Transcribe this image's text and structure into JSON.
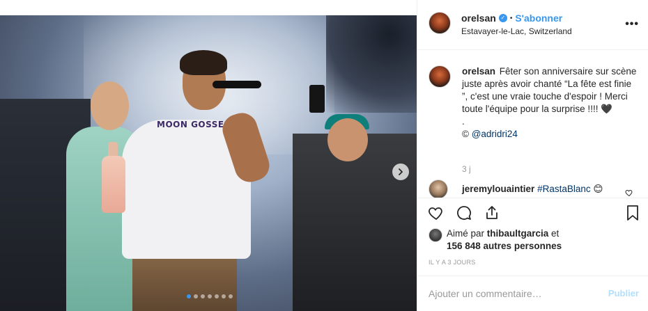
{
  "post": {
    "user": {
      "name": "orelsan",
      "verified": true,
      "follow_label": "S'abonner",
      "separator": "•",
      "location": "Estavayer-le-Lac, Switzerland"
    },
    "photo": {
      "shirt_text": "MOON GOSSE",
      "slide_count": 7,
      "active_slide": 0
    },
    "caption": {
      "username": "orelsan",
      "text": "Fêter son anniversaire sur scène juste après avoir chanté “La fête est finie ”, c'est une vraie touche d'espoir ! Merci toute l'équipe pour la surprise !!!! 🖤",
      "dot": ".",
      "credit_prefix": "© ",
      "credit_mention": "@adridri24",
      "age": "3 j"
    },
    "comment": {
      "username": "jeremylouaintier",
      "tag": "#RastaBlanc",
      "emoji": "😊"
    },
    "likes": {
      "prefix": "Aimé par ",
      "user": "thibaultgarcia",
      "conj": " et",
      "others": "156 848 autres personnes"
    },
    "timestamp": "IL Y A 3 JOURS",
    "composer": {
      "placeholder": "Ajouter un commentaire…",
      "post_label": "Publier"
    },
    "icons": [
      "heart-icon",
      "comment-icon",
      "share-icon",
      "bookmark-icon",
      "more-icon",
      "next-arrow-icon",
      "verified-icon"
    ],
    "colors": {
      "accent": "#3897f0",
      "text": "#262626",
      "muted": "#999999",
      "post_disabled": "#b2dffc"
    }
  }
}
